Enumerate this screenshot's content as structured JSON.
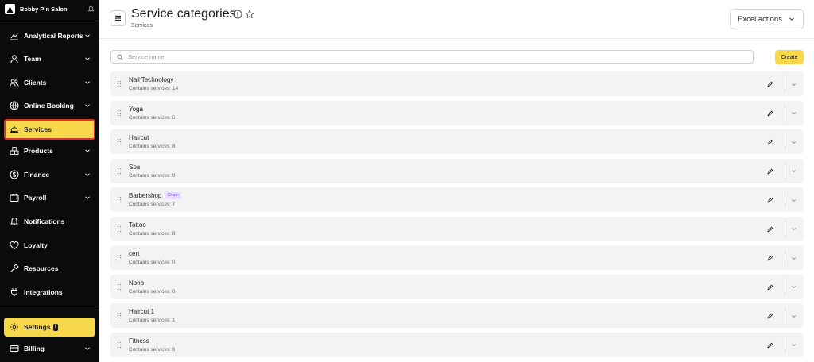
{
  "sidebar": {
    "brand": "Bobby Pin Salon",
    "items": [
      {
        "label": "Analytical Reports",
        "icon": "chart-icon",
        "chevron": true
      },
      {
        "label": "Team",
        "icon": "person-icon",
        "chevron": true
      },
      {
        "label": "Clients",
        "icon": "users-icon",
        "chevron": true
      },
      {
        "label": "Online Booking",
        "icon": "globe-icon",
        "chevron": true
      },
      {
        "label": "Services",
        "icon": "cloche-icon",
        "chevron": false,
        "active": true
      },
      {
        "label": "Products",
        "icon": "boxes-icon",
        "chevron": true
      },
      {
        "label": "Finance",
        "icon": "dollar-icon",
        "chevron": true
      },
      {
        "label": "Payroll",
        "icon": "wallet-icon",
        "chevron": true
      },
      {
        "label": "Notifications",
        "icon": "bell-icon",
        "chevron": false
      },
      {
        "label": "Loyalty",
        "icon": "loyalty-icon",
        "chevron": false
      },
      {
        "label": "Resources",
        "icon": "hammer-icon",
        "chevron": false
      },
      {
        "label": "Integrations",
        "icon": "plug-icon",
        "chevron": false
      }
    ],
    "settings": {
      "label": "Settings",
      "badge": "!"
    },
    "billing": {
      "label": "Billing"
    }
  },
  "header": {
    "title": "Service categories",
    "breadcrumb": "Services",
    "excel_label": "Excel actions"
  },
  "search": {
    "placeholder": "Service name",
    "value": ""
  },
  "create_label": "Create",
  "categories": [
    {
      "name": "Nail Technology",
      "count": "Contains services: 14"
    },
    {
      "name": "Yoga",
      "count": "Contains services: 6"
    },
    {
      "name": "Haircut",
      "count": "Contains services: 8"
    },
    {
      "name": "Spa",
      "count": "Contains services: 0"
    },
    {
      "name": "Barbershop",
      "badge": "Chain",
      "count": "Contains services: 7"
    },
    {
      "name": "Tattoo",
      "count": "Contains services: 8"
    },
    {
      "name": "cert",
      "count": "Contains services: 0"
    },
    {
      "name": "Nono",
      "count": "Contains services: 0"
    },
    {
      "name": "Haircut 1",
      "count": "Contains services: 1"
    },
    {
      "name": "Fitness",
      "count": "Contains services: 6"
    }
  ],
  "colors": {
    "accent": "#f6d84a",
    "sidebar_bg": "#0b0b0b",
    "active_border": "#d8342a",
    "chain_badge": "#7b4de0"
  }
}
